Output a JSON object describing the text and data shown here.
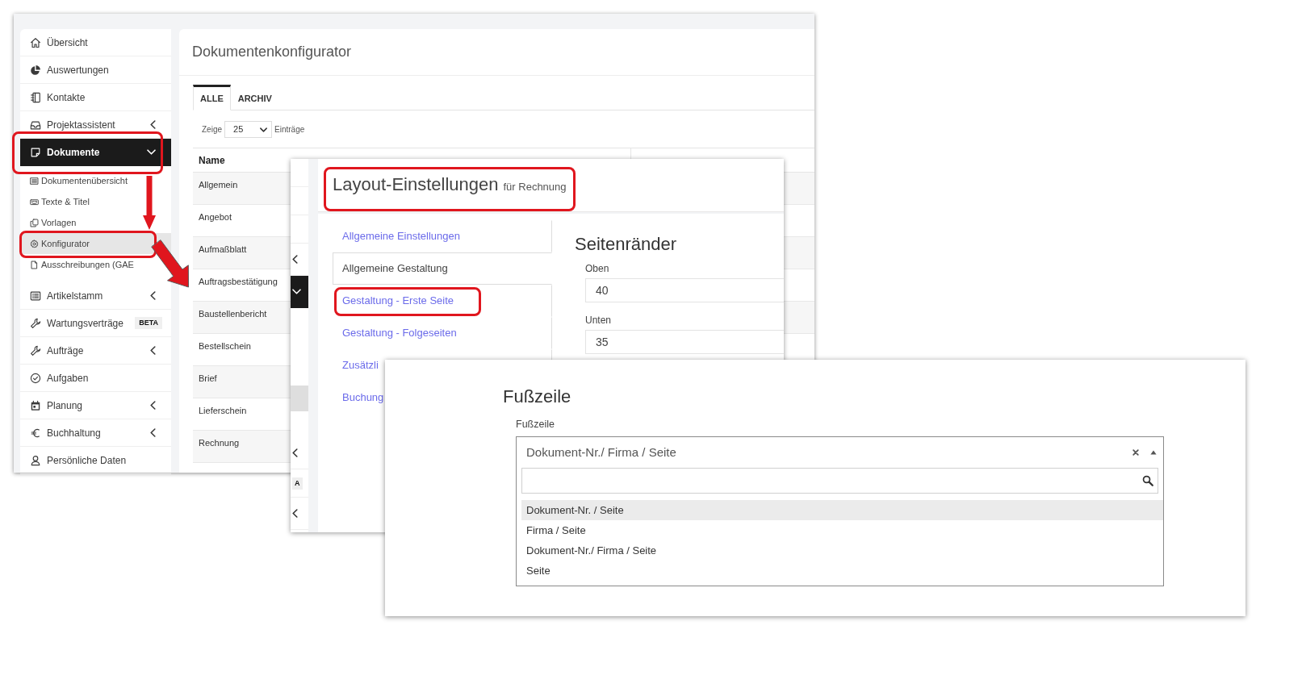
{
  "back_window": {
    "sidebar": {
      "items": [
        {
          "label": "Übersicht",
          "kind": "link",
          "selected": false,
          "annotated": false
        },
        {
          "label": "Auswertungen",
          "kind": "link",
          "selected": false,
          "annotated": false
        },
        {
          "label": "Kontakte",
          "kind": "link",
          "selected": false,
          "annotated": false
        },
        {
          "label": "Projektassistent",
          "kind": "group",
          "expanded": false,
          "selected": false,
          "annotated": false
        },
        {
          "label": "Dokumente",
          "kind": "group",
          "expanded": true,
          "selected": true,
          "annotated": true,
          "children": [
            {
              "label": "Dokumentenübersicht",
              "selected": false,
              "annotated": false
            },
            {
              "label": "Texte & Titel",
              "selected": false,
              "annotated": false
            },
            {
              "label": "Vorlagen",
              "selected": false,
              "annotated": false
            },
            {
              "label": "Konfigurator",
              "selected": true,
              "annotated": true
            },
            {
              "label": "Ausschreibungen (GAE",
              "selected": false,
              "annotated": false
            }
          ]
        },
        {
          "label": "Artikelstamm",
          "kind": "group",
          "expanded": false,
          "selected": false,
          "annotated": false
        },
        {
          "label": "Wartungsverträge",
          "kind": "link",
          "selected": false,
          "annotated": false,
          "badge": "BETA"
        },
        {
          "label": "Aufträge",
          "kind": "group",
          "expanded": false,
          "selected": false,
          "annotated": false
        },
        {
          "label": "Aufgaben",
          "kind": "link",
          "selected": false,
          "annotated": false
        },
        {
          "label": "Planung",
          "kind": "group",
          "expanded": false,
          "selected": false,
          "annotated": false
        },
        {
          "label": "Buchhaltung",
          "kind": "group",
          "expanded": false,
          "selected": false,
          "annotated": false
        },
        {
          "label": "Persönliche Daten",
          "kind": "link",
          "selected": false,
          "annotated": false
        }
      ]
    },
    "page": {
      "title": "Dokumentenkonfigurator",
      "tabs": [
        {
          "label": "ALLE",
          "selected": true
        },
        {
          "label": "ARCHIV",
          "selected": false
        }
      ],
      "length_menu": {
        "label_before": "Zeige",
        "value": "25",
        "label_after": "Einträge"
      },
      "table": {
        "columns": [
          "Name"
        ],
        "rows": [
          {
            "name": "Allgemein"
          },
          {
            "name": "Angebot"
          },
          {
            "name": "Aufmaßblatt"
          },
          {
            "name": "Auftragsbestätigung"
          },
          {
            "name": "Baustellenbericht"
          },
          {
            "name": "Bestellschein"
          },
          {
            "name": "Brief"
          },
          {
            "name": "Lieferschein"
          },
          {
            "name": "Rechnung"
          }
        ]
      }
    }
  },
  "layout_window": {
    "sidebar_edge": {
      "items": [
        {
          "kind": "link",
          "selected": false
        },
        {
          "kind": "link",
          "selected": false
        },
        {
          "kind": "link",
          "selected": false
        },
        {
          "kind": "group",
          "expanded": false,
          "selected": false
        },
        {
          "kind": "group",
          "expanded": true,
          "selected": true
        },
        {
          "kind": "sub",
          "selected": false
        },
        {
          "kind": "sub",
          "selected": false
        },
        {
          "kind": "sub",
          "selected": false
        },
        {
          "kind": "sub",
          "selected": true
        },
        {
          "kind": "sub",
          "selected": false
        },
        {
          "kind": "group",
          "expanded": false,
          "selected": false
        },
        {
          "kind": "link",
          "selected": false,
          "badge": "A"
        },
        {
          "kind": "group",
          "expanded": false,
          "selected": false
        }
      ]
    },
    "header": {
      "title": "Layout-Einstellungen",
      "subtitle": "für Rechnung",
      "annotated": true
    },
    "nav": [
      {
        "label": "Allgemeine Einstellungen",
        "selected": false,
        "annotated": false
      },
      {
        "label": "Allgemeine Gestaltung",
        "selected": true,
        "annotated": false
      },
      {
        "label": "Gestaltung - Erste Seite",
        "selected": false,
        "annotated": true
      },
      {
        "label": "Gestaltung - Folgeseiten",
        "selected": false,
        "annotated": false
      },
      {
        "label": "Zusätzli",
        "selected": false,
        "annotated": false
      },
      {
        "label": "Buchung",
        "selected": false,
        "annotated": false
      }
    ],
    "section": {
      "title": "Seitenränder",
      "fields": [
        {
          "label": "Oben",
          "value": "40"
        },
        {
          "label": "Unten",
          "value": "35"
        }
      ]
    }
  },
  "footer_window": {
    "title": "Fußzeile",
    "field": {
      "label": "Fußzeile",
      "value": "Dokument-Nr./ Firma / Seite",
      "expanded": true,
      "options": [
        {
          "label": "Dokument-Nr. / Seite",
          "highlighted": true
        },
        {
          "label": "Firma / Seite",
          "highlighted": false
        },
        {
          "label": "Dokument-Nr./ Firma / Seite",
          "highlighted": false
        },
        {
          "label": "Seite",
          "highlighted": false
        }
      ]
    }
  }
}
